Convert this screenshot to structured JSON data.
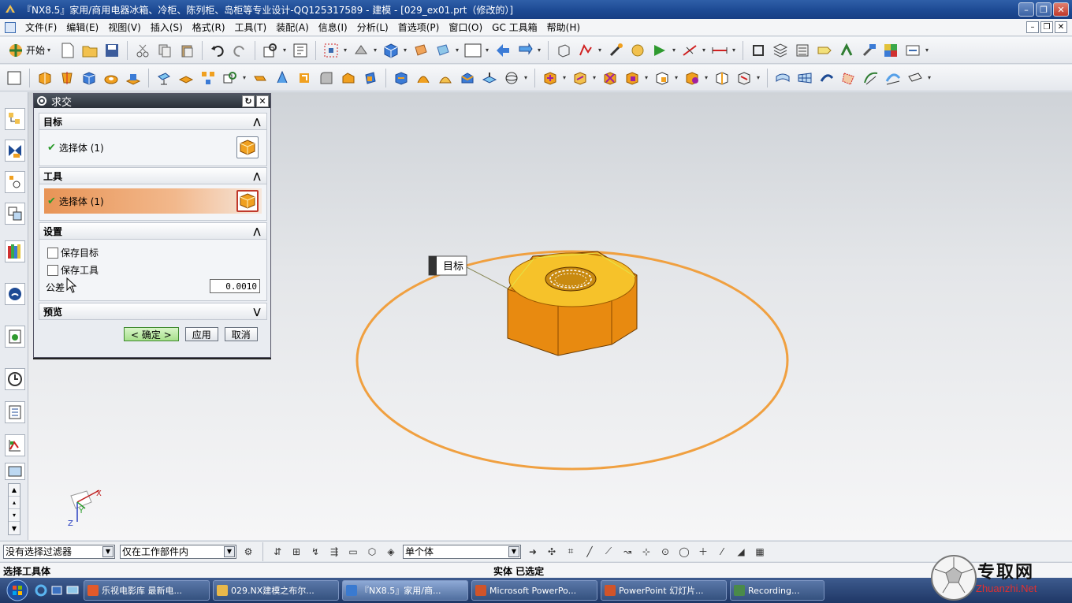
{
  "window": {
    "title": "『NX8.5』家用/商用电器冰箱、冷柜、陈列柜、岛柜等专业设计-QQ125317589 - 建模 - [029_ex01.prt（修改的）]"
  },
  "menu": {
    "items": [
      "文件(F)",
      "编辑(E)",
      "视图(V)",
      "插入(S)",
      "格式(R)",
      "工具(T)",
      "装配(A)",
      "信息(I)",
      "分析(L)",
      "首选项(P)",
      "窗口(O)",
      "GC 工具箱",
      "帮助(H)"
    ]
  },
  "toolbar": {
    "start_label": "开始"
  },
  "dialog": {
    "title": "求交",
    "target": {
      "header": "目标",
      "select_label": "选择体 (1)"
    },
    "tool": {
      "header": "工具",
      "select_label": "选择体 (1)"
    },
    "settings": {
      "header": "设置",
      "keep_target": "保存目标",
      "keep_tool": "保存工具",
      "tolerance_label": "公差",
      "tolerance_value": "0.0010"
    },
    "preview": {
      "header": "预览"
    },
    "buttons": {
      "ok": "< 确定 >",
      "apply": "应用",
      "cancel": "取消"
    }
  },
  "viewport": {
    "target_tag": "目标",
    "axis_x": "X",
    "axis_y": "Y",
    "axis_z": "Z",
    "colors": {
      "body": "#f0a020",
      "circle": "#f0a040",
      "highlight": "#e3e34a"
    }
  },
  "filters": {
    "selection_filter": "没有选择过滤器",
    "scope": "仅在工作部件内",
    "body_type": "单个体"
  },
  "status": {
    "prompt": "选择工具体",
    "info": "实体 已选定"
  },
  "taskbar": {
    "tasks": [
      {
        "label": "乐视电影库 最新电...",
        "color": "#e25a2a"
      },
      {
        "label": "029.NX建模之布尔...",
        "color": "#e8b84a"
      },
      {
        "label": "『NX8.5』家用/商...",
        "color": "#3a7ad0"
      },
      {
        "label": "Microsoft PowerPo...",
        "color": "#d0542a"
      },
      {
        "label": "PowerPoint 幻灯片...",
        "color": "#d0542a"
      },
      {
        "label": "Recording...",
        "color": "#4a8a4a"
      }
    ]
  },
  "watermark": {
    "text": "专取网",
    "url": "Zhuanzhi.Net"
  }
}
